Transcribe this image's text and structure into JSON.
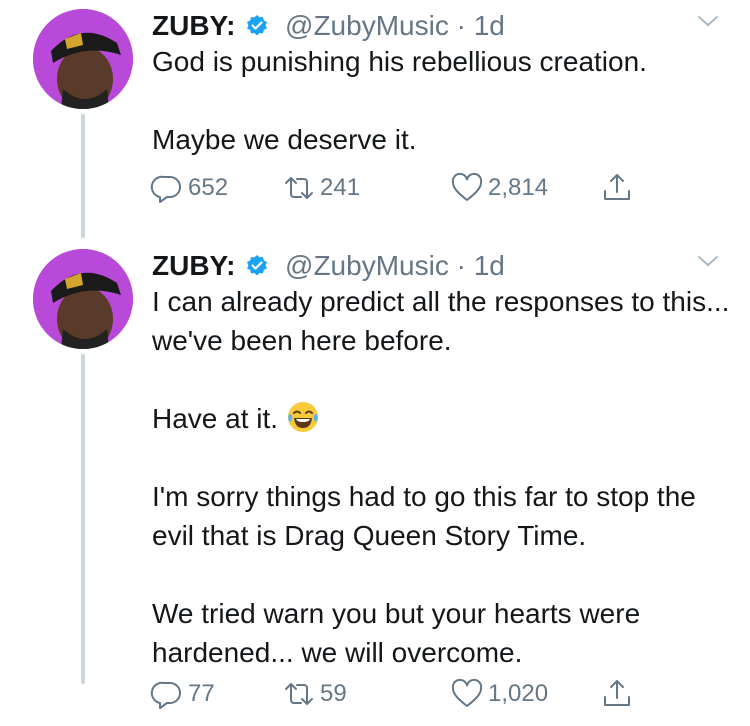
{
  "tweets": [
    {
      "name": "ZUBY:",
      "handle": "@ZubyMusic",
      "separator": "·",
      "time": "1d",
      "text": "God is punishing his rebellious creation.\n\nMaybe we deserve it.",
      "replies": "652",
      "retweets": "241",
      "likes": "2,814"
    },
    {
      "name": "ZUBY:",
      "handle": "@ZubyMusic",
      "separator": "·",
      "time": "1d",
      "text_line1": "I can already predict all the responses to this... we've been here before.\n\nHave at it. ",
      "text_line2": "\n\nI'm sorry things had to go this far to stop the evil that is Drag Queen Story Time.\n\nWe tried warn you but your hearts were hardened... we will overcome.",
      "replies": "77",
      "retweets": "59",
      "likes": "1,020"
    }
  ],
  "colors": {
    "verified": "#1da1f2",
    "secondary_text": "#657786",
    "thread_line": "#ccd6dd",
    "avatar_bg": "#b94ad9"
  },
  "icons": [
    "reply-icon",
    "retweet-icon",
    "like-icon",
    "share-icon",
    "chevron-down-icon",
    "verified-badge-icon",
    "laughing-emoji-icon"
  ]
}
